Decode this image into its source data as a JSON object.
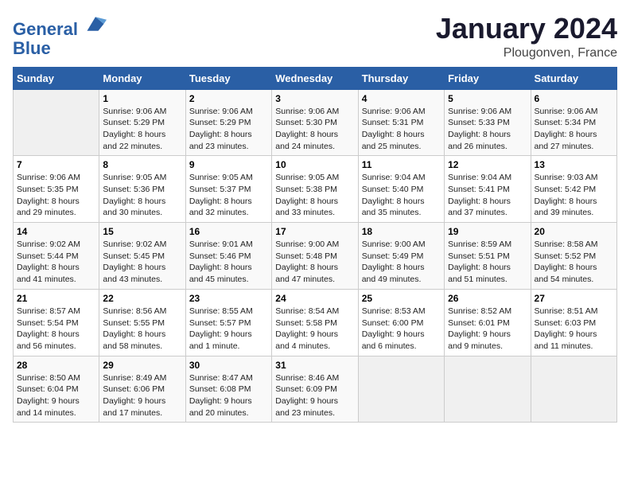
{
  "header": {
    "logo_line1": "General",
    "logo_line2": "Blue",
    "month": "January 2024",
    "location": "Plougonven, France"
  },
  "weekdays": [
    "Sunday",
    "Monday",
    "Tuesday",
    "Wednesday",
    "Thursday",
    "Friday",
    "Saturday"
  ],
  "weeks": [
    [
      {
        "day": "",
        "info": ""
      },
      {
        "day": "1",
        "info": "Sunrise: 9:06 AM\nSunset: 5:29 PM\nDaylight: 8 hours\nand 22 minutes."
      },
      {
        "day": "2",
        "info": "Sunrise: 9:06 AM\nSunset: 5:29 PM\nDaylight: 8 hours\nand 23 minutes."
      },
      {
        "day": "3",
        "info": "Sunrise: 9:06 AM\nSunset: 5:30 PM\nDaylight: 8 hours\nand 24 minutes."
      },
      {
        "day": "4",
        "info": "Sunrise: 9:06 AM\nSunset: 5:31 PM\nDaylight: 8 hours\nand 25 minutes."
      },
      {
        "day": "5",
        "info": "Sunrise: 9:06 AM\nSunset: 5:33 PM\nDaylight: 8 hours\nand 26 minutes."
      },
      {
        "day": "6",
        "info": "Sunrise: 9:06 AM\nSunset: 5:34 PM\nDaylight: 8 hours\nand 27 minutes."
      }
    ],
    [
      {
        "day": "7",
        "info": "Sunrise: 9:06 AM\nSunset: 5:35 PM\nDaylight: 8 hours\nand 29 minutes."
      },
      {
        "day": "8",
        "info": "Sunrise: 9:05 AM\nSunset: 5:36 PM\nDaylight: 8 hours\nand 30 minutes."
      },
      {
        "day": "9",
        "info": "Sunrise: 9:05 AM\nSunset: 5:37 PM\nDaylight: 8 hours\nand 32 minutes."
      },
      {
        "day": "10",
        "info": "Sunrise: 9:05 AM\nSunset: 5:38 PM\nDaylight: 8 hours\nand 33 minutes."
      },
      {
        "day": "11",
        "info": "Sunrise: 9:04 AM\nSunset: 5:40 PM\nDaylight: 8 hours\nand 35 minutes."
      },
      {
        "day": "12",
        "info": "Sunrise: 9:04 AM\nSunset: 5:41 PM\nDaylight: 8 hours\nand 37 minutes."
      },
      {
        "day": "13",
        "info": "Sunrise: 9:03 AM\nSunset: 5:42 PM\nDaylight: 8 hours\nand 39 minutes."
      }
    ],
    [
      {
        "day": "14",
        "info": "Sunrise: 9:02 AM\nSunset: 5:44 PM\nDaylight: 8 hours\nand 41 minutes."
      },
      {
        "day": "15",
        "info": "Sunrise: 9:02 AM\nSunset: 5:45 PM\nDaylight: 8 hours\nand 43 minutes."
      },
      {
        "day": "16",
        "info": "Sunrise: 9:01 AM\nSunset: 5:46 PM\nDaylight: 8 hours\nand 45 minutes."
      },
      {
        "day": "17",
        "info": "Sunrise: 9:00 AM\nSunset: 5:48 PM\nDaylight: 8 hours\nand 47 minutes."
      },
      {
        "day": "18",
        "info": "Sunrise: 9:00 AM\nSunset: 5:49 PM\nDaylight: 8 hours\nand 49 minutes."
      },
      {
        "day": "19",
        "info": "Sunrise: 8:59 AM\nSunset: 5:51 PM\nDaylight: 8 hours\nand 51 minutes."
      },
      {
        "day": "20",
        "info": "Sunrise: 8:58 AM\nSunset: 5:52 PM\nDaylight: 8 hours\nand 54 minutes."
      }
    ],
    [
      {
        "day": "21",
        "info": "Sunrise: 8:57 AM\nSunset: 5:54 PM\nDaylight: 8 hours\nand 56 minutes."
      },
      {
        "day": "22",
        "info": "Sunrise: 8:56 AM\nSunset: 5:55 PM\nDaylight: 8 hours\nand 58 minutes."
      },
      {
        "day": "23",
        "info": "Sunrise: 8:55 AM\nSunset: 5:57 PM\nDaylight: 9 hours\nand 1 minute."
      },
      {
        "day": "24",
        "info": "Sunrise: 8:54 AM\nSunset: 5:58 PM\nDaylight: 9 hours\nand 4 minutes."
      },
      {
        "day": "25",
        "info": "Sunrise: 8:53 AM\nSunset: 6:00 PM\nDaylight: 9 hours\nand 6 minutes."
      },
      {
        "day": "26",
        "info": "Sunrise: 8:52 AM\nSunset: 6:01 PM\nDaylight: 9 hours\nand 9 minutes."
      },
      {
        "day": "27",
        "info": "Sunrise: 8:51 AM\nSunset: 6:03 PM\nDaylight: 9 hours\nand 11 minutes."
      }
    ],
    [
      {
        "day": "28",
        "info": "Sunrise: 8:50 AM\nSunset: 6:04 PM\nDaylight: 9 hours\nand 14 minutes."
      },
      {
        "day": "29",
        "info": "Sunrise: 8:49 AM\nSunset: 6:06 PM\nDaylight: 9 hours\nand 17 minutes."
      },
      {
        "day": "30",
        "info": "Sunrise: 8:47 AM\nSunset: 6:08 PM\nDaylight: 9 hours\nand 20 minutes."
      },
      {
        "day": "31",
        "info": "Sunrise: 8:46 AM\nSunset: 6:09 PM\nDaylight: 9 hours\nand 23 minutes."
      },
      {
        "day": "",
        "info": ""
      },
      {
        "day": "",
        "info": ""
      },
      {
        "day": "",
        "info": ""
      }
    ]
  ]
}
